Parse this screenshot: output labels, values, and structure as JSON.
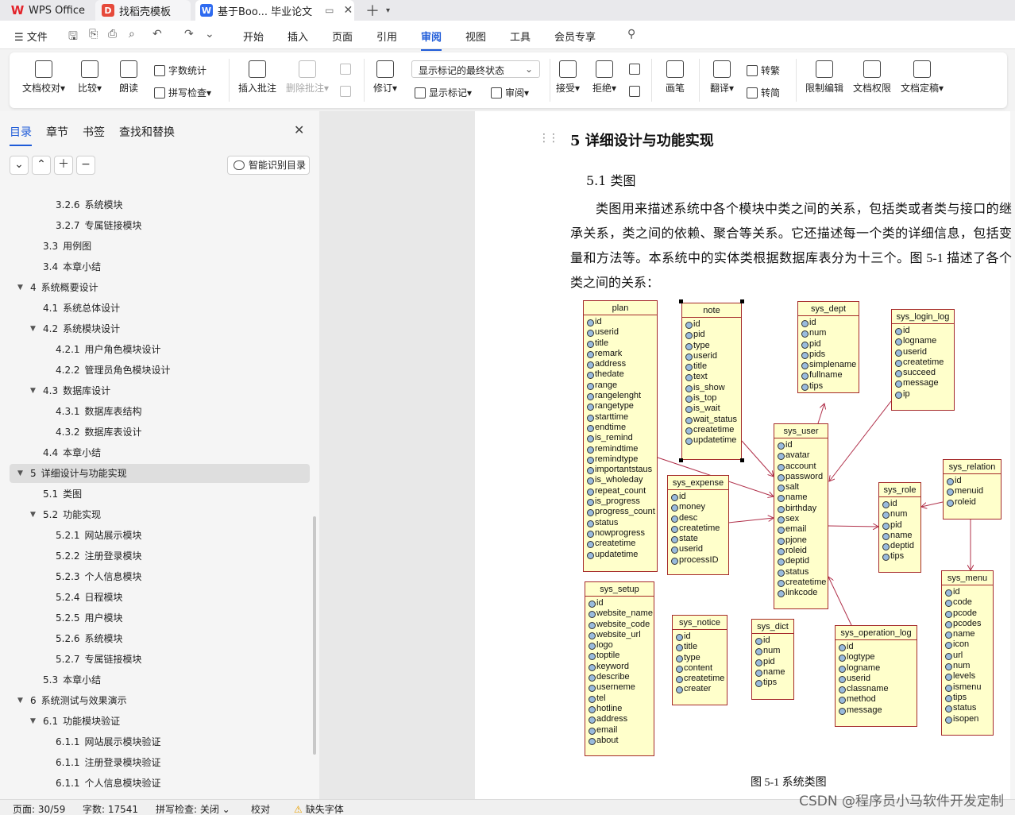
{
  "tabs": {
    "wps": "WPS Office",
    "templates": "找稻壳模板",
    "doc": "基于Boo... 毕业论文"
  },
  "menu": {
    "file": "文件",
    "items": [
      "开始",
      "插入",
      "页面",
      "引用",
      "审阅",
      "视图",
      "工具",
      "会员专享"
    ],
    "active": "审阅"
  },
  "ribbon": {
    "doc_check": "文档校对",
    "compare": "比较",
    "read_aloud": "朗读",
    "word_count": "字数统计",
    "spell_check": "拼写检查",
    "insert_comment": "插入批注",
    "delete_comment": "删除批注",
    "revise": "修订",
    "mark_state": "显示标记的最终状态",
    "show_marks": "显示标记",
    "review": "审阅",
    "accept": "接受",
    "reject": "拒绝",
    "pen": "画笔",
    "translate": "翻译",
    "to_traditional": "转繁",
    "to_simplified": "转简",
    "restrict_edit": "限制编辑",
    "doc_permission": "文档权限",
    "finalize": "文档定稿"
  },
  "nav": {
    "tabs": [
      "目录",
      "章节",
      "书签",
      "查找和替换"
    ],
    "smart_toc": "智能识别目录",
    "toc": [
      {
        "num": "3.2.6",
        "text": "系统模块"
      },
      {
        "num": "3.2.7",
        "text": "专属链接模块"
      },
      {
        "num": "3.3",
        "text": "用例图"
      },
      {
        "num": "3.4",
        "text": "本章小结"
      },
      {
        "num": "4",
        "text": "系统概要设计"
      },
      {
        "num": "4.1",
        "text": "系统总体设计"
      },
      {
        "num": "4.2",
        "text": "系统模块设计"
      },
      {
        "num": "4.2.1",
        "text": "用户角色模块设计"
      },
      {
        "num": "4.2.2",
        "text": "管理员角色模块设计"
      },
      {
        "num": "4.3",
        "text": "数据库设计"
      },
      {
        "num": "4.3.1",
        "text": "数据库表结构"
      },
      {
        "num": "4.3.2",
        "text": "数据库表设计"
      },
      {
        "num": "4.4",
        "text": "本章小结"
      },
      {
        "num": "5",
        "text": "详细设计与功能实现"
      },
      {
        "num": "5.1",
        "text": "类图"
      },
      {
        "num": "5.2",
        "text": "功能实现"
      },
      {
        "num": "5.2.1",
        "text": "网站展示模块"
      },
      {
        "num": "5.2.2",
        "text": "注册登录模块"
      },
      {
        "num": "5.2.3",
        "text": "个人信息模块"
      },
      {
        "num": "5.2.4",
        "text": "日程模块"
      },
      {
        "num": "5.2.5",
        "text": "用户模块"
      },
      {
        "num": "5.2.6",
        "text": "系统模块"
      },
      {
        "num": "5.2.7",
        "text": "专属链接模块"
      },
      {
        "num": "5.3",
        "text": "本章小结"
      },
      {
        "num": "6",
        "text": "系统测试与效果演示"
      },
      {
        "num": "6.1",
        "text": "功能模块验证"
      },
      {
        "num": "6.1.1",
        "text": "网站展示模块验证"
      },
      {
        "num": "6.1.1",
        "text": "注册登录模块验证"
      },
      {
        "num": "6.1.1",
        "text": "个人信息模块验证"
      }
    ]
  },
  "doc": {
    "h1": "5  详细设计与功能实现",
    "h2": "5.1   类图",
    "para": "类图用来描述系统中各个模块中类之间的关系，包括类或者类与接口的继承关系，类之间的依赖、聚合等关系。它还描述每一个类的详细信息，包括变量和方法等。本系统中的实体类根据数据库表分为十三个。图 5-1 描述了各个类之间的关系：",
    "caption": "图 5-1  系统类图",
    "classes": {
      "plan": {
        "name": "plan",
        "fields": [
          "id",
          "userid",
          "title",
          "remark",
          "address",
          "thedate",
          "range",
          "rangelenght",
          "rangetype",
          "starttime",
          "endtime",
          "is_remind",
          "remindtime",
          "remindtype",
          "importantstaus",
          "is_wholeday",
          "repeat_count",
          "is_progress",
          "progress_count",
          "status",
          "nowprogress",
          "createtime",
          "updatetime"
        ]
      },
      "note": {
        "name": "note",
        "fields": [
          "id",
          "pid",
          "type",
          "userid",
          "title",
          "text",
          "is_show",
          "is_top",
          "is_wait",
          "wait_status",
          "createtime",
          "updatetime"
        ]
      },
      "sys_dept": {
        "name": "sys_dept",
        "fields": [
          "id",
          "num",
          "pid",
          "pids",
          "simplename",
          "fullname",
          "tips"
        ]
      },
      "sys_login_log": {
        "name": "sys_login_log",
        "fields": [
          "id",
          "logname",
          "userid",
          "createtime",
          "succeed",
          "message",
          "ip"
        ]
      },
      "sys_user": {
        "name": "sys_user",
        "fields": [
          "id",
          "avatar",
          "account",
          "password",
          "salt",
          "name",
          "birthday",
          "sex",
          "email",
          "pjone",
          "roleid",
          "deptid",
          "status",
          "createtime",
          "linkcode"
        ]
      },
      "sys_expense": {
        "name": "sys_expense",
        "fields": [
          "id",
          "money",
          "desc",
          "createtime",
          "state",
          "userid",
          "processID"
        ]
      },
      "sys_role": {
        "name": "sys_role",
        "fields": [
          "id",
          "num",
          "pid",
          "name",
          "deptid",
          "tips"
        ]
      },
      "sys_relation": {
        "name": "sys_relation",
        "fields": [
          "id",
          "menuid",
          "roleid"
        ]
      },
      "sys_menu": {
        "name": "sys_menu",
        "fields": [
          "id",
          "code",
          "pcode",
          "pcodes",
          "name",
          "icon",
          "url",
          "num",
          "levels",
          "ismenu",
          "tips",
          "status",
          "isopen"
        ]
      },
      "sys_setup": {
        "name": "sys_setup",
        "fields": [
          "id",
          "website_name",
          "website_code",
          "website_url",
          "logo",
          "toptile",
          "keyword",
          "describe",
          "userneme",
          "tel",
          "hotline",
          "address",
          "email",
          "about"
        ]
      },
      "sys_notice": {
        "name": "sys_notice",
        "fields": [
          "id",
          "title",
          "type",
          "content",
          "createtime",
          "creater"
        ]
      },
      "sys_dict": {
        "name": "sys_dict",
        "fields": [
          "id",
          "num",
          "pid",
          "name",
          "tips"
        ]
      },
      "sys_operation_log": {
        "name": "sys_operation_log",
        "fields": [
          "id",
          "logtype",
          "logname",
          "userid",
          "classname",
          "method",
          "message"
        ]
      }
    }
  },
  "status": {
    "page": "页面: 30/59",
    "words": "字数: 17541",
    "spell": "拼写检查: 关闭",
    "proof": "校对",
    "missing_font": "缺失字体"
  },
  "watermark": "CSDN @程序员小马软件开发定制",
  "colors": {
    "accent": "#1e5bd8",
    "class_fill": "#ffffcb",
    "class_border": "#a52a2a"
  }
}
